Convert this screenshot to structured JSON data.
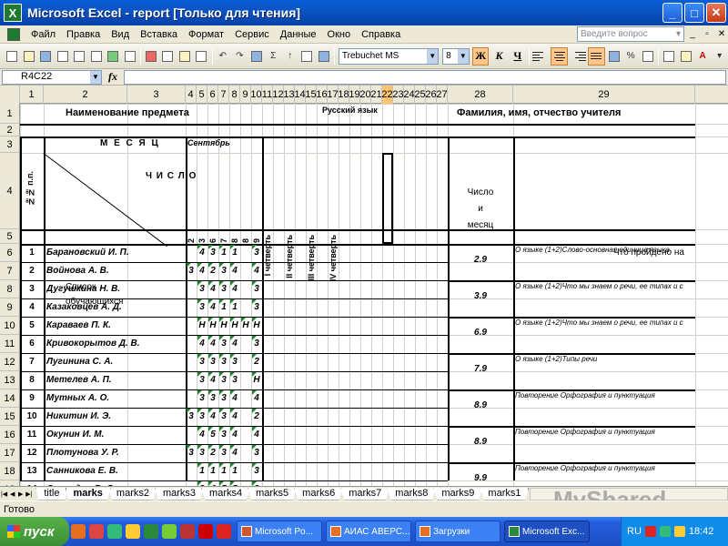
{
  "window": {
    "title": "Microsoft Excel - report  [Только для чтения]",
    "app_icon": "X"
  },
  "menu": {
    "items": [
      "Файл",
      "Правка",
      "Вид",
      "Вставка",
      "Формат",
      "Сервис",
      "Данные",
      "Окно",
      "Справка"
    ],
    "help_placeholder": "Введите вопрос"
  },
  "toolbar": {
    "font": "Trebuchet MS",
    "size": "8",
    "bold": "Ж",
    "italic": "К",
    "underline": "Ч",
    "percent": "%"
  },
  "formula": {
    "cell_ref": "R4C22",
    "fx": "fx",
    "value": ""
  },
  "columns": [
    "1",
    "2",
    "3",
    "4",
    "5",
    "6",
    "7",
    "8",
    "9",
    "10",
    "11",
    "12",
    "13",
    "14",
    "15",
    "16",
    "17",
    "18",
    "19",
    "20",
    "21",
    "22",
    "23",
    "24",
    "25",
    "26",
    "27",
    "28",
    "29"
  ],
  "selected_column": "22",
  "rows": [
    "1",
    "2",
    "3",
    "4",
    "5",
    "6",
    "7",
    "8",
    "9",
    "10",
    "11",
    "12",
    "13",
    "14",
    "15",
    "16",
    "17",
    "18",
    "19"
  ],
  "sheet": {
    "subject_label": "Наименование предмета",
    "subject": "Русский язык",
    "teacher_label": "Фамилия, имя, отчество учителя",
    "month_label": "М Е С Я Ц",
    "month": "Сентябрь",
    "day_label": "Ч И С Л О",
    "list_label_1": "Список",
    "list_label_2": "обучающихся",
    "num_label": "№№ п.п.",
    "days": [
      "2",
      "3",
      "6",
      "7",
      "8",
      "8",
      "9"
    ],
    "quarters": [
      "I четверть",
      "II четверть",
      "III четверть",
      "IV четверть"
    ],
    "date_header": [
      "Число",
      "и",
      "месяц"
    ],
    "topic_header": "Что пройдено на",
    "students": [
      {
        "num": "1",
        "name": "Барановский И. П.",
        "marks": [
          "",
          "4",
          "3",
          "1",
          "1",
          "",
          "3"
        ]
      },
      {
        "num": "2",
        "name": "Войнова А. В.",
        "marks": [
          "3",
          "4",
          "2",
          "3",
          "4",
          "",
          "4"
        ]
      },
      {
        "num": "3",
        "name": "Дугушкина Н. В.",
        "marks": [
          "",
          "3",
          "4",
          "3",
          "4",
          "",
          "3"
        ]
      },
      {
        "num": "4",
        "name": "Казаковцев А. Д.",
        "marks": [
          "",
          "3",
          "4",
          "1",
          "1",
          "",
          "3"
        ]
      },
      {
        "num": "5",
        "name": "Караваев П. К.",
        "marks": [
          "",
          "Н",
          "Н",
          "Н",
          "Н",
          "Н",
          "Н"
        ]
      },
      {
        "num": "6",
        "name": "Кривокорытов Д. В.",
        "marks": [
          "",
          "4",
          "4",
          "3",
          "4",
          "",
          "3"
        ]
      },
      {
        "num": "7",
        "name": "Лугинина С. А.",
        "marks": [
          "",
          "3",
          "3",
          "3",
          "3",
          "",
          "2"
        ]
      },
      {
        "num": "8",
        "name": "Метелев А. П.",
        "marks": [
          "",
          "3",
          "4",
          "3",
          "3",
          "",
          "Н"
        ]
      },
      {
        "num": "9",
        "name": "Мутных А. О.",
        "marks": [
          "",
          "3",
          "3",
          "3",
          "4",
          "",
          "4"
        ]
      },
      {
        "num": "10",
        "name": "Никитин И. Э.",
        "marks": [
          "3",
          "3",
          "4",
          "3",
          "4",
          "",
          "2"
        ]
      },
      {
        "num": "11",
        "name": "Окунин И. М.",
        "marks": [
          "",
          "4",
          "5",
          "3",
          "4",
          "",
          "4"
        ]
      },
      {
        "num": "12",
        "name": "Плотунова У. Р.",
        "marks": [
          "3",
          "3",
          "2",
          "3",
          "4",
          "",
          "3"
        ]
      },
      {
        "num": "13",
        "name": "Санникова Е. В.",
        "marks": [
          "",
          "1",
          "1",
          "1",
          "1",
          "",
          "3"
        ]
      },
      {
        "num": "14",
        "name": "Свиридов В. Д.",
        "marks": [
          "",
          "3",
          "4",
          "5",
          "5",
          "",
          "3"
        ]
      }
    ],
    "dates": [
      "2.9",
      "3.9",
      "6.9",
      "7.9",
      "8.9",
      "8.9",
      "9.9"
    ],
    "topics": [
      "О языке (1+2)Слово-основная единица языка",
      "О языке (1+2)Что мы знаем о речи, ее типах и с",
      "О языке (1+2)Что мы знаем о речи, ее типах и с",
      "О языке (1+2)Типы речи",
      "Повторение Орфография и пунктуация",
      "Повторение Орфография и пунктуация",
      "Повторение Орфография и пунктуация"
    ]
  },
  "tabs": [
    "title",
    "marks",
    "marks2",
    "marks3",
    "marks4",
    "marks5",
    "marks6",
    "marks7",
    "marks8",
    "marks9",
    "marks1"
  ],
  "active_tab": "marks",
  "status": "Готово",
  "watermark": "MyShared",
  "taskbar": {
    "start": "пуск",
    "tasks": [
      "Microsoft Po...",
      "АИАС АВЕРС...",
      "Загрузки",
      "Microsoft Exc..."
    ],
    "lang": "RU",
    "time": "18:42"
  }
}
